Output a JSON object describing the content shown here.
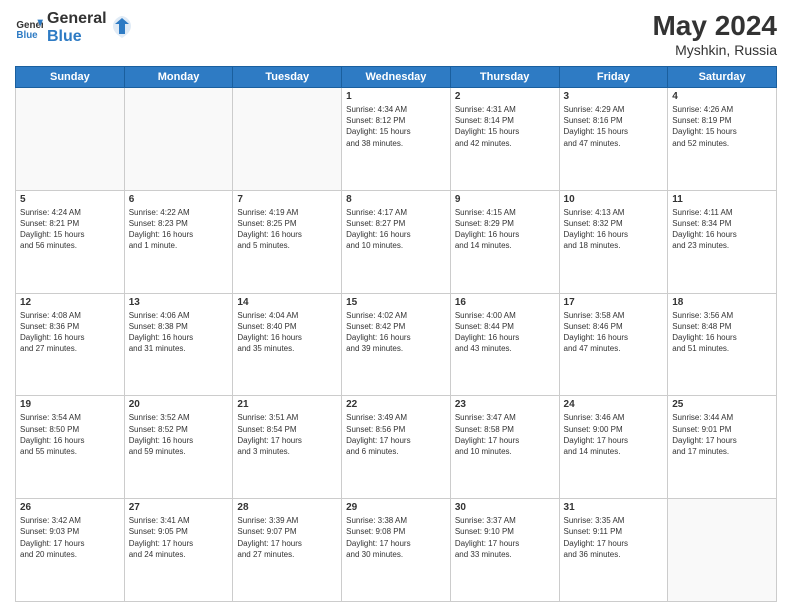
{
  "header": {
    "logo_general": "General",
    "logo_blue": "Blue",
    "month_year": "May 2024",
    "location": "Myshkin, Russia"
  },
  "days_of_week": [
    "Sunday",
    "Monday",
    "Tuesday",
    "Wednesday",
    "Thursday",
    "Friday",
    "Saturday"
  ],
  "weeks": [
    [
      {
        "day": "",
        "info": ""
      },
      {
        "day": "",
        "info": ""
      },
      {
        "day": "",
        "info": ""
      },
      {
        "day": "1",
        "info": "Sunrise: 4:34 AM\nSunset: 8:12 PM\nDaylight: 15 hours\nand 38 minutes."
      },
      {
        "day": "2",
        "info": "Sunrise: 4:31 AM\nSunset: 8:14 PM\nDaylight: 15 hours\nand 42 minutes."
      },
      {
        "day": "3",
        "info": "Sunrise: 4:29 AM\nSunset: 8:16 PM\nDaylight: 15 hours\nand 47 minutes."
      },
      {
        "day": "4",
        "info": "Sunrise: 4:26 AM\nSunset: 8:19 PM\nDaylight: 15 hours\nand 52 minutes."
      }
    ],
    [
      {
        "day": "5",
        "info": "Sunrise: 4:24 AM\nSunset: 8:21 PM\nDaylight: 15 hours\nand 56 minutes."
      },
      {
        "day": "6",
        "info": "Sunrise: 4:22 AM\nSunset: 8:23 PM\nDaylight: 16 hours\nand 1 minute."
      },
      {
        "day": "7",
        "info": "Sunrise: 4:19 AM\nSunset: 8:25 PM\nDaylight: 16 hours\nand 5 minutes."
      },
      {
        "day": "8",
        "info": "Sunrise: 4:17 AM\nSunset: 8:27 PM\nDaylight: 16 hours\nand 10 minutes."
      },
      {
        "day": "9",
        "info": "Sunrise: 4:15 AM\nSunset: 8:29 PM\nDaylight: 16 hours\nand 14 minutes."
      },
      {
        "day": "10",
        "info": "Sunrise: 4:13 AM\nSunset: 8:32 PM\nDaylight: 16 hours\nand 18 minutes."
      },
      {
        "day": "11",
        "info": "Sunrise: 4:11 AM\nSunset: 8:34 PM\nDaylight: 16 hours\nand 23 minutes."
      }
    ],
    [
      {
        "day": "12",
        "info": "Sunrise: 4:08 AM\nSunset: 8:36 PM\nDaylight: 16 hours\nand 27 minutes."
      },
      {
        "day": "13",
        "info": "Sunrise: 4:06 AM\nSunset: 8:38 PM\nDaylight: 16 hours\nand 31 minutes."
      },
      {
        "day": "14",
        "info": "Sunrise: 4:04 AM\nSunset: 8:40 PM\nDaylight: 16 hours\nand 35 minutes."
      },
      {
        "day": "15",
        "info": "Sunrise: 4:02 AM\nSunset: 8:42 PM\nDaylight: 16 hours\nand 39 minutes."
      },
      {
        "day": "16",
        "info": "Sunrise: 4:00 AM\nSunset: 8:44 PM\nDaylight: 16 hours\nand 43 minutes."
      },
      {
        "day": "17",
        "info": "Sunrise: 3:58 AM\nSunset: 8:46 PM\nDaylight: 16 hours\nand 47 minutes."
      },
      {
        "day": "18",
        "info": "Sunrise: 3:56 AM\nSunset: 8:48 PM\nDaylight: 16 hours\nand 51 minutes."
      }
    ],
    [
      {
        "day": "19",
        "info": "Sunrise: 3:54 AM\nSunset: 8:50 PM\nDaylight: 16 hours\nand 55 minutes."
      },
      {
        "day": "20",
        "info": "Sunrise: 3:52 AM\nSunset: 8:52 PM\nDaylight: 16 hours\nand 59 minutes."
      },
      {
        "day": "21",
        "info": "Sunrise: 3:51 AM\nSunset: 8:54 PM\nDaylight: 17 hours\nand 3 minutes."
      },
      {
        "day": "22",
        "info": "Sunrise: 3:49 AM\nSunset: 8:56 PM\nDaylight: 17 hours\nand 6 minutes."
      },
      {
        "day": "23",
        "info": "Sunrise: 3:47 AM\nSunset: 8:58 PM\nDaylight: 17 hours\nand 10 minutes."
      },
      {
        "day": "24",
        "info": "Sunrise: 3:46 AM\nSunset: 9:00 PM\nDaylight: 17 hours\nand 14 minutes."
      },
      {
        "day": "25",
        "info": "Sunrise: 3:44 AM\nSunset: 9:01 PM\nDaylight: 17 hours\nand 17 minutes."
      }
    ],
    [
      {
        "day": "26",
        "info": "Sunrise: 3:42 AM\nSunset: 9:03 PM\nDaylight: 17 hours\nand 20 minutes."
      },
      {
        "day": "27",
        "info": "Sunrise: 3:41 AM\nSunset: 9:05 PM\nDaylight: 17 hours\nand 24 minutes."
      },
      {
        "day": "28",
        "info": "Sunrise: 3:39 AM\nSunset: 9:07 PM\nDaylight: 17 hours\nand 27 minutes."
      },
      {
        "day": "29",
        "info": "Sunrise: 3:38 AM\nSunset: 9:08 PM\nDaylight: 17 hours\nand 30 minutes."
      },
      {
        "day": "30",
        "info": "Sunrise: 3:37 AM\nSunset: 9:10 PM\nDaylight: 17 hours\nand 33 minutes."
      },
      {
        "day": "31",
        "info": "Sunrise: 3:35 AM\nSunset: 9:11 PM\nDaylight: 17 hours\nand 36 minutes."
      },
      {
        "day": "",
        "info": ""
      }
    ]
  ]
}
